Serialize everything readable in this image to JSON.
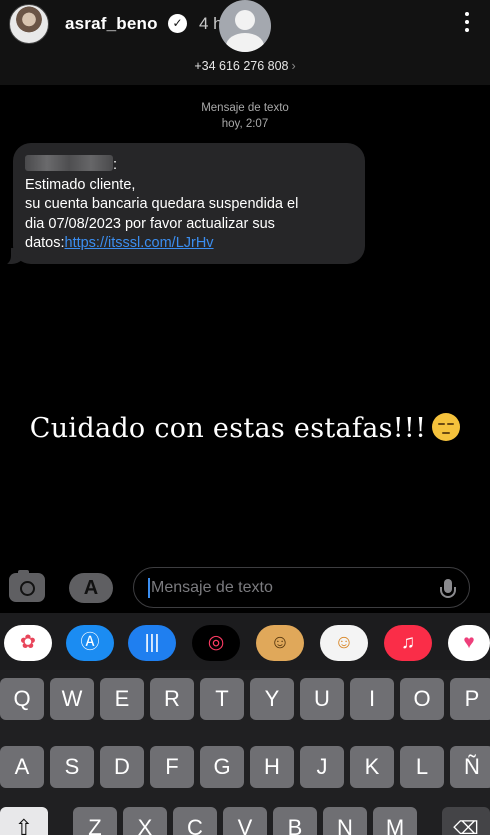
{
  "header": {
    "username": "asraf_beno",
    "time": "4 h",
    "phone": "+34 616 276 808"
  },
  "thread": {
    "label": "Mensaje de texto",
    "timestamp": "hoy, 2:07"
  },
  "message": {
    "sender_suffix": ":",
    "line1": "Estimado cliente,",
    "line2": "su cuenta bancaria quedara suspendida el",
    "line3": "dia 07/08/2023 por favor actualizar sus",
    "line4_prefix": "datos:",
    "link": "https://itsssl.com/LJrHv"
  },
  "caption": {
    "text": "Cuidado con estas estafas!!!",
    "emoji": "unamused-face"
  },
  "composer": {
    "placeholder": "Mensaje de texto"
  },
  "apps": [
    {
      "name": "photos-app-icon",
      "glyph": "✿",
      "bg": "#ffffff",
      "fg": "#e8455a"
    },
    {
      "name": "app-store-icon",
      "glyph": "Ⓐ",
      "bg": "#1b8cf2",
      "fg": "#ffffff"
    },
    {
      "name": "audio-message-icon",
      "glyph": "|||",
      "bg": "#1f7ff0",
      "fg": "#ffffff"
    },
    {
      "name": "fitness-icon",
      "glyph": "◎",
      "bg": "#000000",
      "fg": "#ff3b64"
    },
    {
      "name": "memoji-icon",
      "glyph": "☺",
      "bg": "#e0a85a",
      "fg": "#5a3a10"
    },
    {
      "name": "memoji-stickers-icon",
      "glyph": "☺",
      "bg": "#f4f4f4",
      "fg": "#d9882a"
    },
    {
      "name": "music-app-icon",
      "glyph": "♫",
      "bg": "#fa2d48",
      "fg": "#ffffff"
    },
    {
      "name": "digital-touch-icon",
      "glyph": "♥",
      "bg": "#ffffff",
      "fg": "#ee3e7a"
    }
  ],
  "keyboard": {
    "row1": [
      "Q",
      "W",
      "E",
      "R",
      "T",
      "Y",
      "U",
      "I",
      "O",
      "P"
    ],
    "row2": [
      "A",
      "S",
      "D",
      "F",
      "G",
      "H",
      "J",
      "K",
      "L",
      "Ñ"
    ],
    "row3": [
      "Z",
      "X",
      "C",
      "V",
      "B",
      "N",
      "M"
    ]
  },
  "colors": {
    "accent_link": "#3b8ef0",
    "bubble": "#262628",
    "header": "#121212"
  }
}
